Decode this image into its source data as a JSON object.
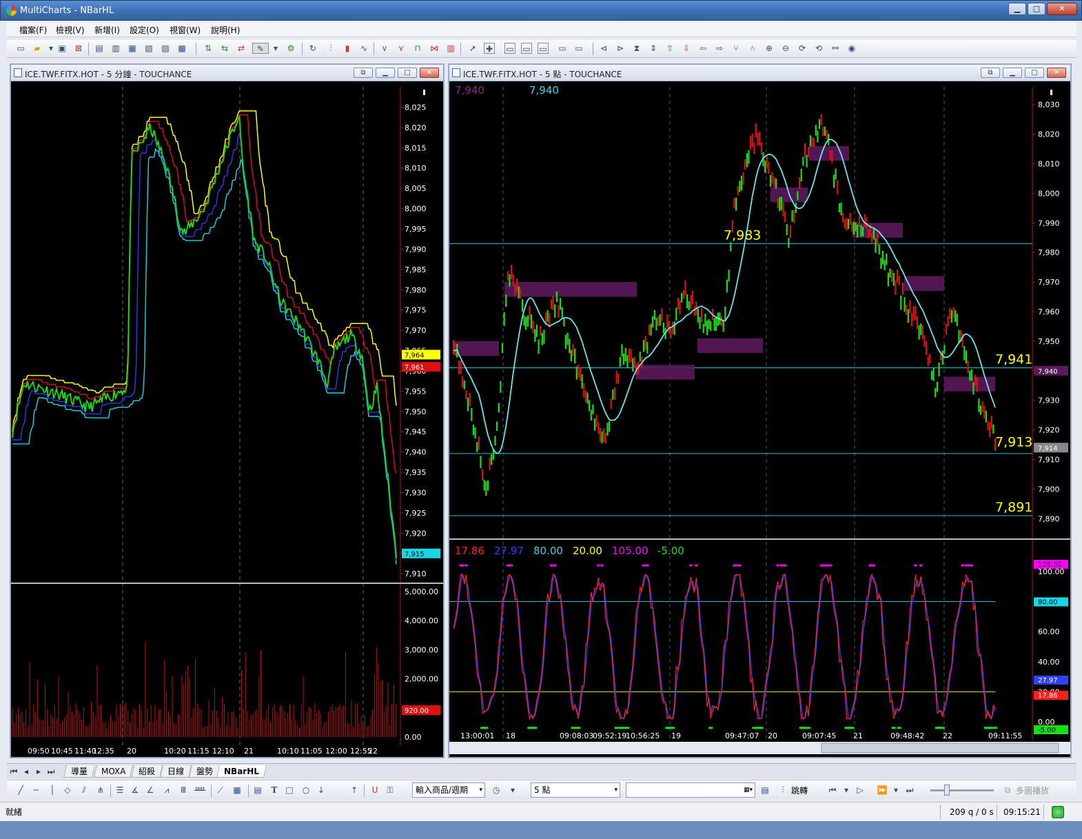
{
  "window": {
    "title": "MultiCharts - NBarHL",
    "minimize_label": "▁",
    "maximize_label": "□",
    "close_label": "✕"
  },
  "menu": [
    "檔案(F)",
    "檢視(V)",
    "新增(I)",
    "設定(O)",
    "視窗(W)",
    "說明(H)"
  ],
  "left_window": {
    "title": "ICE.TWF.FITX.HOT - 5 分鐘 - TOUCHANCE",
    "price_axis": [
      "8,025",
      "8,020",
      "8,015",
      "8,010",
      "8,005",
      "8,000",
      "7,995",
      "7,990",
      "7,985",
      "7,980",
      "7,975",
      "7,970",
      "7,965",
      "7,960",
      "7,955",
      "7,950",
      "7,945",
      "7,940",
      "7,935",
      "7,930",
      "7,925",
      "7,920",
      "7,915",
      "7,910"
    ],
    "tags": {
      "upper": "7,964",
      "lower": "7,961",
      "last": "7,915"
    },
    "volume_axis": [
      "5,000.00",
      "4,000.00",
      "3,000.00",
      "2,000.00",
      "1,000.00",
      "0.00"
    ],
    "volume_tag": "920.00",
    "time_axis": [
      "09:50",
      "10:45",
      "11:40",
      "12:35",
      "20",
      "10:20",
      "11:15",
      "12:10",
      "21",
      "10:10",
      "11:05",
      "12:00",
      "12:55",
      "22"
    ],
    "colors": {
      "yellow": "#ffff00",
      "red": "#e01010",
      "green": "#16e016",
      "blue": "#2b3df2",
      "cyan": "#14d8e8"
    }
  },
  "right_window": {
    "title": "ICE.TWF.FITX.HOT - 5 點 - TOUCHANCE",
    "header_values": [
      {
        "text": "7,940",
        "color": "#8b2a8b"
      },
      {
        "text": "7,940",
        "color": "#2ed8e8"
      }
    ],
    "price_axis": [
      "8,030",
      "8,020",
      "8,010",
      "8,000",
      "7,990",
      "7,980",
      "7,970",
      "7,960",
      "7,950",
      "7,940",
      "7,930",
      "7,920",
      "7,910",
      "7,900",
      "7,890"
    ],
    "level_labels": [
      "7,983",
      "7,941",
      "7,913",
      "7,891"
    ],
    "tags": {
      "cyan": "7,940",
      "last": "7,914"
    },
    "osc_header": [
      {
        "text": "17.86",
        "color": "#ff2020"
      },
      {
        "text": "27.97",
        "color": "#3040ff"
      },
      {
        "text": "80.00",
        "color": "#2ed8e8"
      },
      {
        "text": "20.00",
        "color": "#ffff00"
      },
      {
        "text": "105.00",
        "color": "#ff00ff"
      },
      {
        "text": "-5.00",
        "color": "#16e016"
      }
    ],
    "osc_axis": [
      "100.00",
      "80.00",
      "60.00",
      "40.00",
      "20.00",
      "0.00"
    ],
    "osc_tags": {
      "magenta": "105.00",
      "cyan": "80.00",
      "blue": "27.97",
      "red": "17.86",
      "green": "-5.00"
    },
    "time_axis": [
      "13:00:01",
      "18",
      "09:08:03",
      "09:52:19",
      "10:56:25",
      "19",
      "09:47:07",
      "20",
      "09:07:45",
      "21",
      "09:48:42",
      "22",
      "09:11:55"
    ]
  },
  "tabs": [
    "導量",
    "MOXA",
    "紹殺",
    "日線",
    "盤勢",
    "NBarHL"
  ],
  "drawbar": {
    "symbol_combo": "輸入商品/週期",
    "interval_combo": "5 點",
    "jump_label": "跳轉",
    "multi_label": "多圖播放"
  },
  "status": {
    "text": "就緒",
    "rate": "209 q / 0 s",
    "time": "09:15:21"
  }
}
